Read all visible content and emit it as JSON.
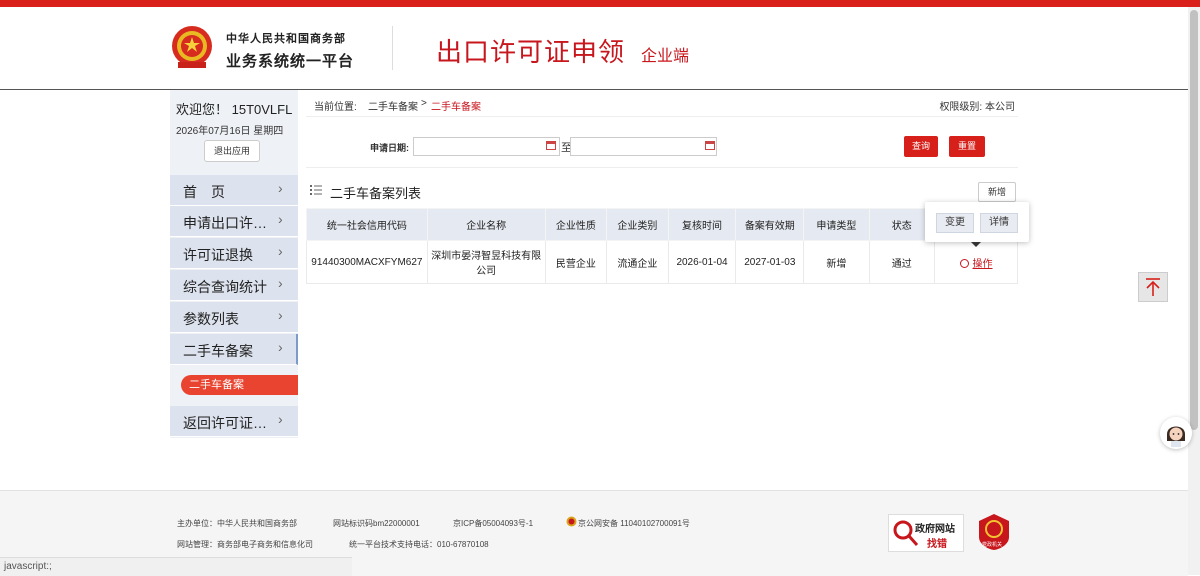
{
  "header": {
    "org_line1": "中华人民共和国商务部",
    "org_line2": "业务系统统一平台",
    "title": "出口许可证申领",
    "subtitle": "企业端"
  },
  "user": {
    "welcome": "欢迎您！ 15T0VLFL",
    "date": "2026年07月16日 星期四",
    "logout_label": "退出应用"
  },
  "sidebar": {
    "items": [
      {
        "label": "首　页"
      },
      {
        "label": "申请出口许…"
      },
      {
        "label": "许可证退换"
      },
      {
        "label": "综合查询统计"
      },
      {
        "label": "参数列表"
      },
      {
        "label": "二手车备案"
      },
      {
        "label": "返回许可证…"
      }
    ],
    "sub_item": "二手车备案"
  },
  "breadcrumb": {
    "label": "当前位置:",
    "level1": "二手车备案",
    "separator": ">",
    "level2": "二手车备案",
    "permission": "权限级别: 本公司"
  },
  "search": {
    "date_label": "申请日期:",
    "to_label": "至",
    "query_label": "查询",
    "reset_label": "重置"
  },
  "list": {
    "title": "二手车备案列表",
    "add_label": "新增",
    "columns": [
      "统一社会信用代码",
      "企业名称",
      "企业性质",
      "企业类别",
      "复核时间",
      "备案有效期",
      "申请类型",
      "状态",
      ""
    ],
    "rows": [
      {
        "credit_code": "91440300MACXFYM627",
        "company": "深圳市晏浔智昱科技有限公司",
        "nature": "民营企业",
        "category": "流通企业",
        "review_time": "2026-01-04",
        "valid_until": "2027-01-03",
        "apply_type": "新增",
        "status": "通过",
        "op_label": "操作"
      }
    ],
    "popup": {
      "change_label": "变更",
      "detail_label": "详情"
    }
  },
  "footer": {
    "sponsor": "主办单位：中华人民共和国商务部",
    "site_id": "网站标识码bm22000001",
    "icp": "京ICP备05004093号-1",
    "police": "京公网安备 11040102700091号",
    "management": "网站管理：商务部电子商务和信息化司",
    "support": "统一平台技术支持电话：010-67870108",
    "badge1_line1": "政府网站",
    "badge1_line2": "找错",
    "badge2_text": "党政机关"
  },
  "statusbar": {
    "text": "javascript:;"
  },
  "colors": {
    "brand_red": "#d7201a",
    "nav_bg": "#dde3ee",
    "table_header": "#e5e9f1"
  }
}
